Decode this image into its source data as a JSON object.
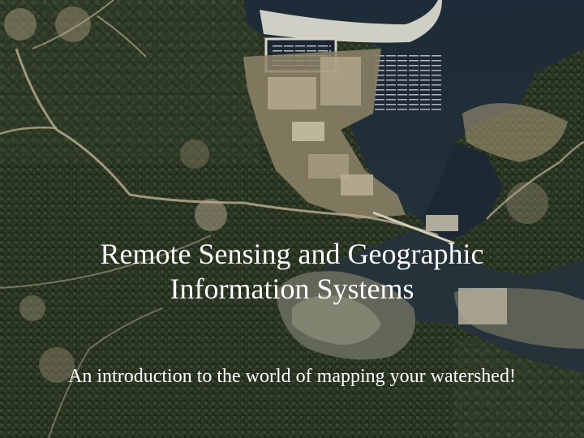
{
  "slide": {
    "title": "Remote Sensing and Geographic Information Systems",
    "subtitle": "An introduction to the world of mapping your watershed!"
  },
  "background": {
    "description_icon": "aerial-photo-icon",
    "colors": {
      "forest_dark": "#1f2a1b",
      "forest_mid": "#34402a",
      "water_dark": "#1a2630",
      "sand": "#b9a786",
      "developed": "#c7b8a0"
    }
  }
}
